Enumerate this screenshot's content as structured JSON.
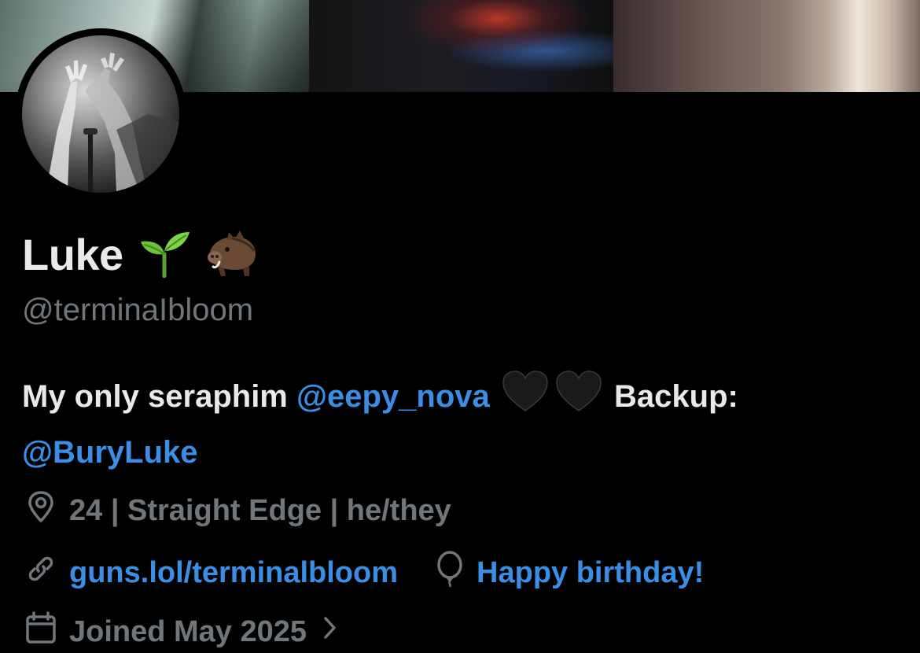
{
  "profile": {
    "display_name": "Luke",
    "name_emojis": [
      "seedling-emoji",
      "boar-emoji"
    ],
    "handle": "@terminaIbloom",
    "bio": {
      "text_1": "My only seraphim",
      "mention_1": "@eepy_nova",
      "text_2": "Backup:",
      "mention_2": "@BuryLuke"
    },
    "location": "24 | Straight Edge | he/they",
    "website": "guns.lol/terminalbloom",
    "birthday": "Happy birthday!",
    "joined": "Joined May 2025"
  },
  "colors": {
    "background": "#000000",
    "primary_text": "#e7e9ea",
    "secondary_text": "#71767b",
    "link": "#3a8ee6"
  }
}
